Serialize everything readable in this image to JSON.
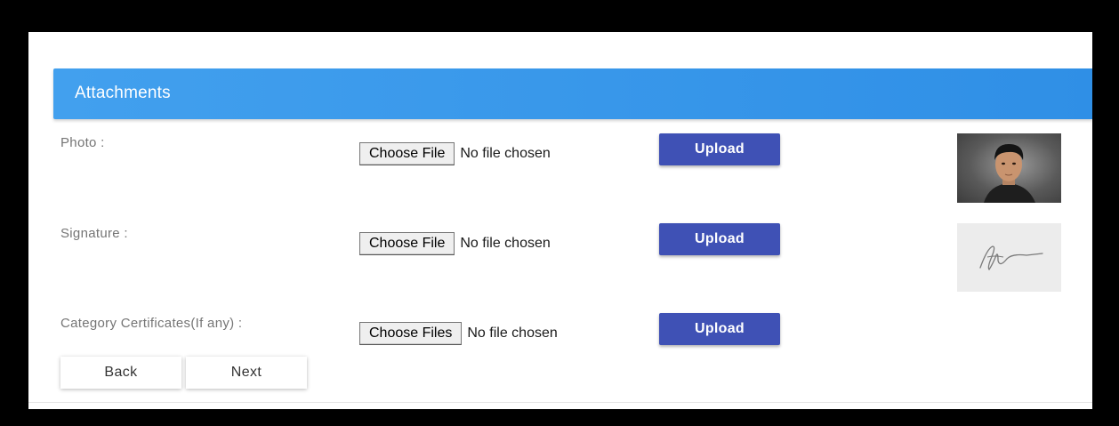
{
  "panel": {
    "title": "Attachments"
  },
  "rows": [
    {
      "label": "Photo :",
      "choose_label": "Choose File",
      "status": "No file chosen",
      "upload_label": "Upload"
    },
    {
      "label": "Signature :",
      "choose_label": "Choose File",
      "status": "No file chosen",
      "upload_label": "Upload"
    },
    {
      "label": "Category Certificates(If any) :",
      "choose_label": "Choose Files",
      "status": "No file chosen",
      "upload_label": "Upload"
    }
  ],
  "previews": {
    "photo": "person-portrait",
    "signature": "handwritten-signature"
  },
  "nav": {
    "back_label": "Back",
    "next_label": "Next"
  },
  "colors": {
    "header": "#3d9bea",
    "upload": "#3f51b5"
  }
}
